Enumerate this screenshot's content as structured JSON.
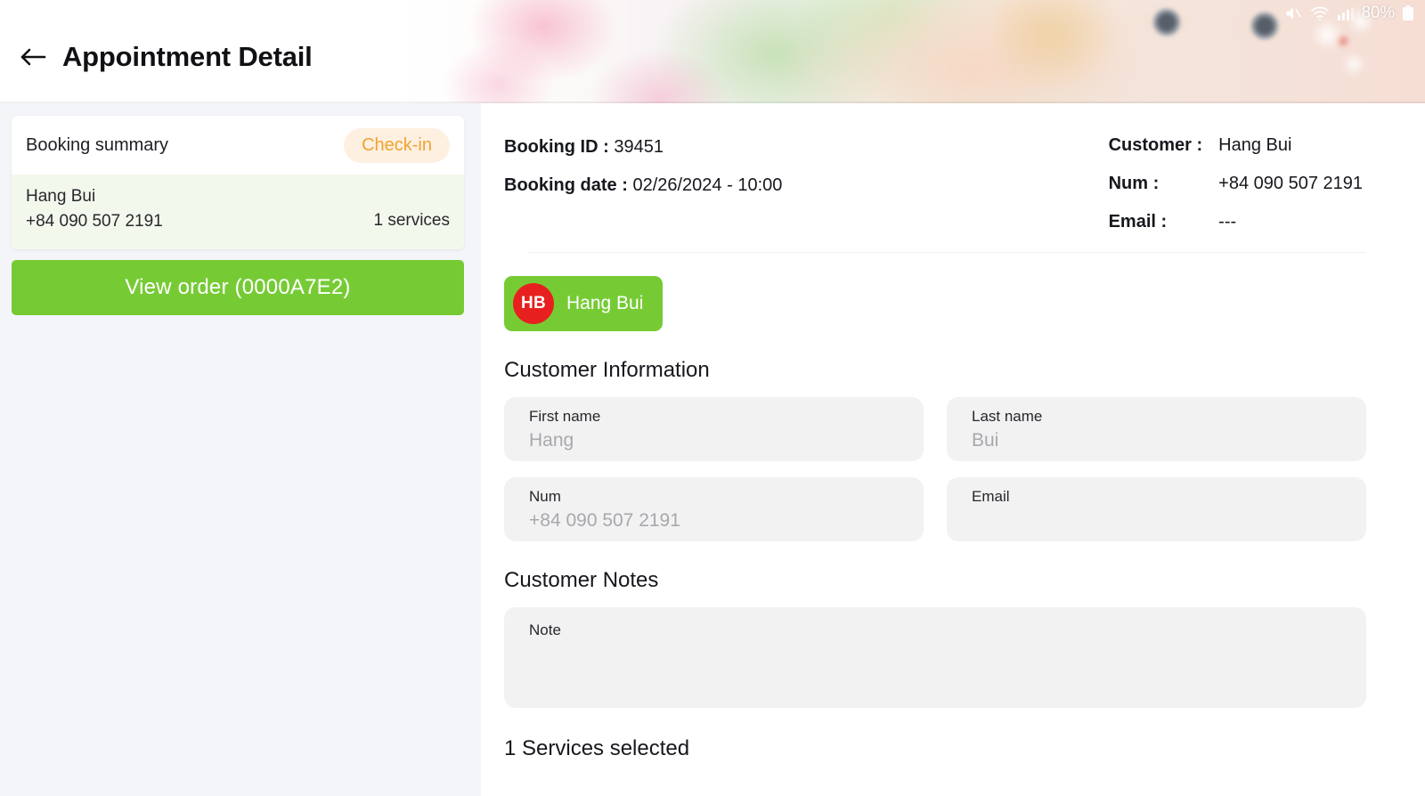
{
  "statusbar": {
    "mute_icon": "mute-icon",
    "wifi_icon": "wifi-icon",
    "signal_icon": "cellular-signal-icon",
    "battery_pct": "80%",
    "battery_icon": "battery-icon"
  },
  "header": {
    "back_icon": "back-arrow-icon",
    "title": "Appointment Detail"
  },
  "summary": {
    "title": "Booking summary",
    "status_badge": "Check-in",
    "customer_name": "Hang Bui",
    "customer_phone": "+84 090 507 2191",
    "service_count": "1 services",
    "view_order_label": "View order  (0000A7E2)"
  },
  "booking": {
    "booking_id_label": "Booking ID :",
    "booking_id_value": "39451",
    "booking_date_label": "Booking date :",
    "booking_date_value": "02/26/2024 - 10:00",
    "customer_label": "Customer :",
    "customer_value": "Hang Bui",
    "num_label": "Num :",
    "num_value": "+84 090 507 2191",
    "email_label": "Email :",
    "email_value": "---"
  },
  "chip": {
    "initials": "HB",
    "name": "Hang Bui"
  },
  "customer_information": {
    "heading": "Customer Information",
    "fields": [
      {
        "label": "First name",
        "value": "Hang"
      },
      {
        "label": "Last name",
        "value": "Bui"
      },
      {
        "label": "Num",
        "value": "+84 090 507 2191"
      },
      {
        "label": "Email",
        "value": ""
      }
    ]
  },
  "customer_notes": {
    "heading": "Customer Notes",
    "note_label": "Note",
    "note_value": ""
  },
  "services": {
    "heading": "1 Services selected"
  },
  "colors": {
    "brand_green": "#76cb35",
    "avatar_red": "#e7201f",
    "badge_orange": "#f0a330",
    "badge_bg": "#fdf0e1",
    "page_bg": "#f4f5f8",
    "field_bg": "#f2f2f3"
  }
}
